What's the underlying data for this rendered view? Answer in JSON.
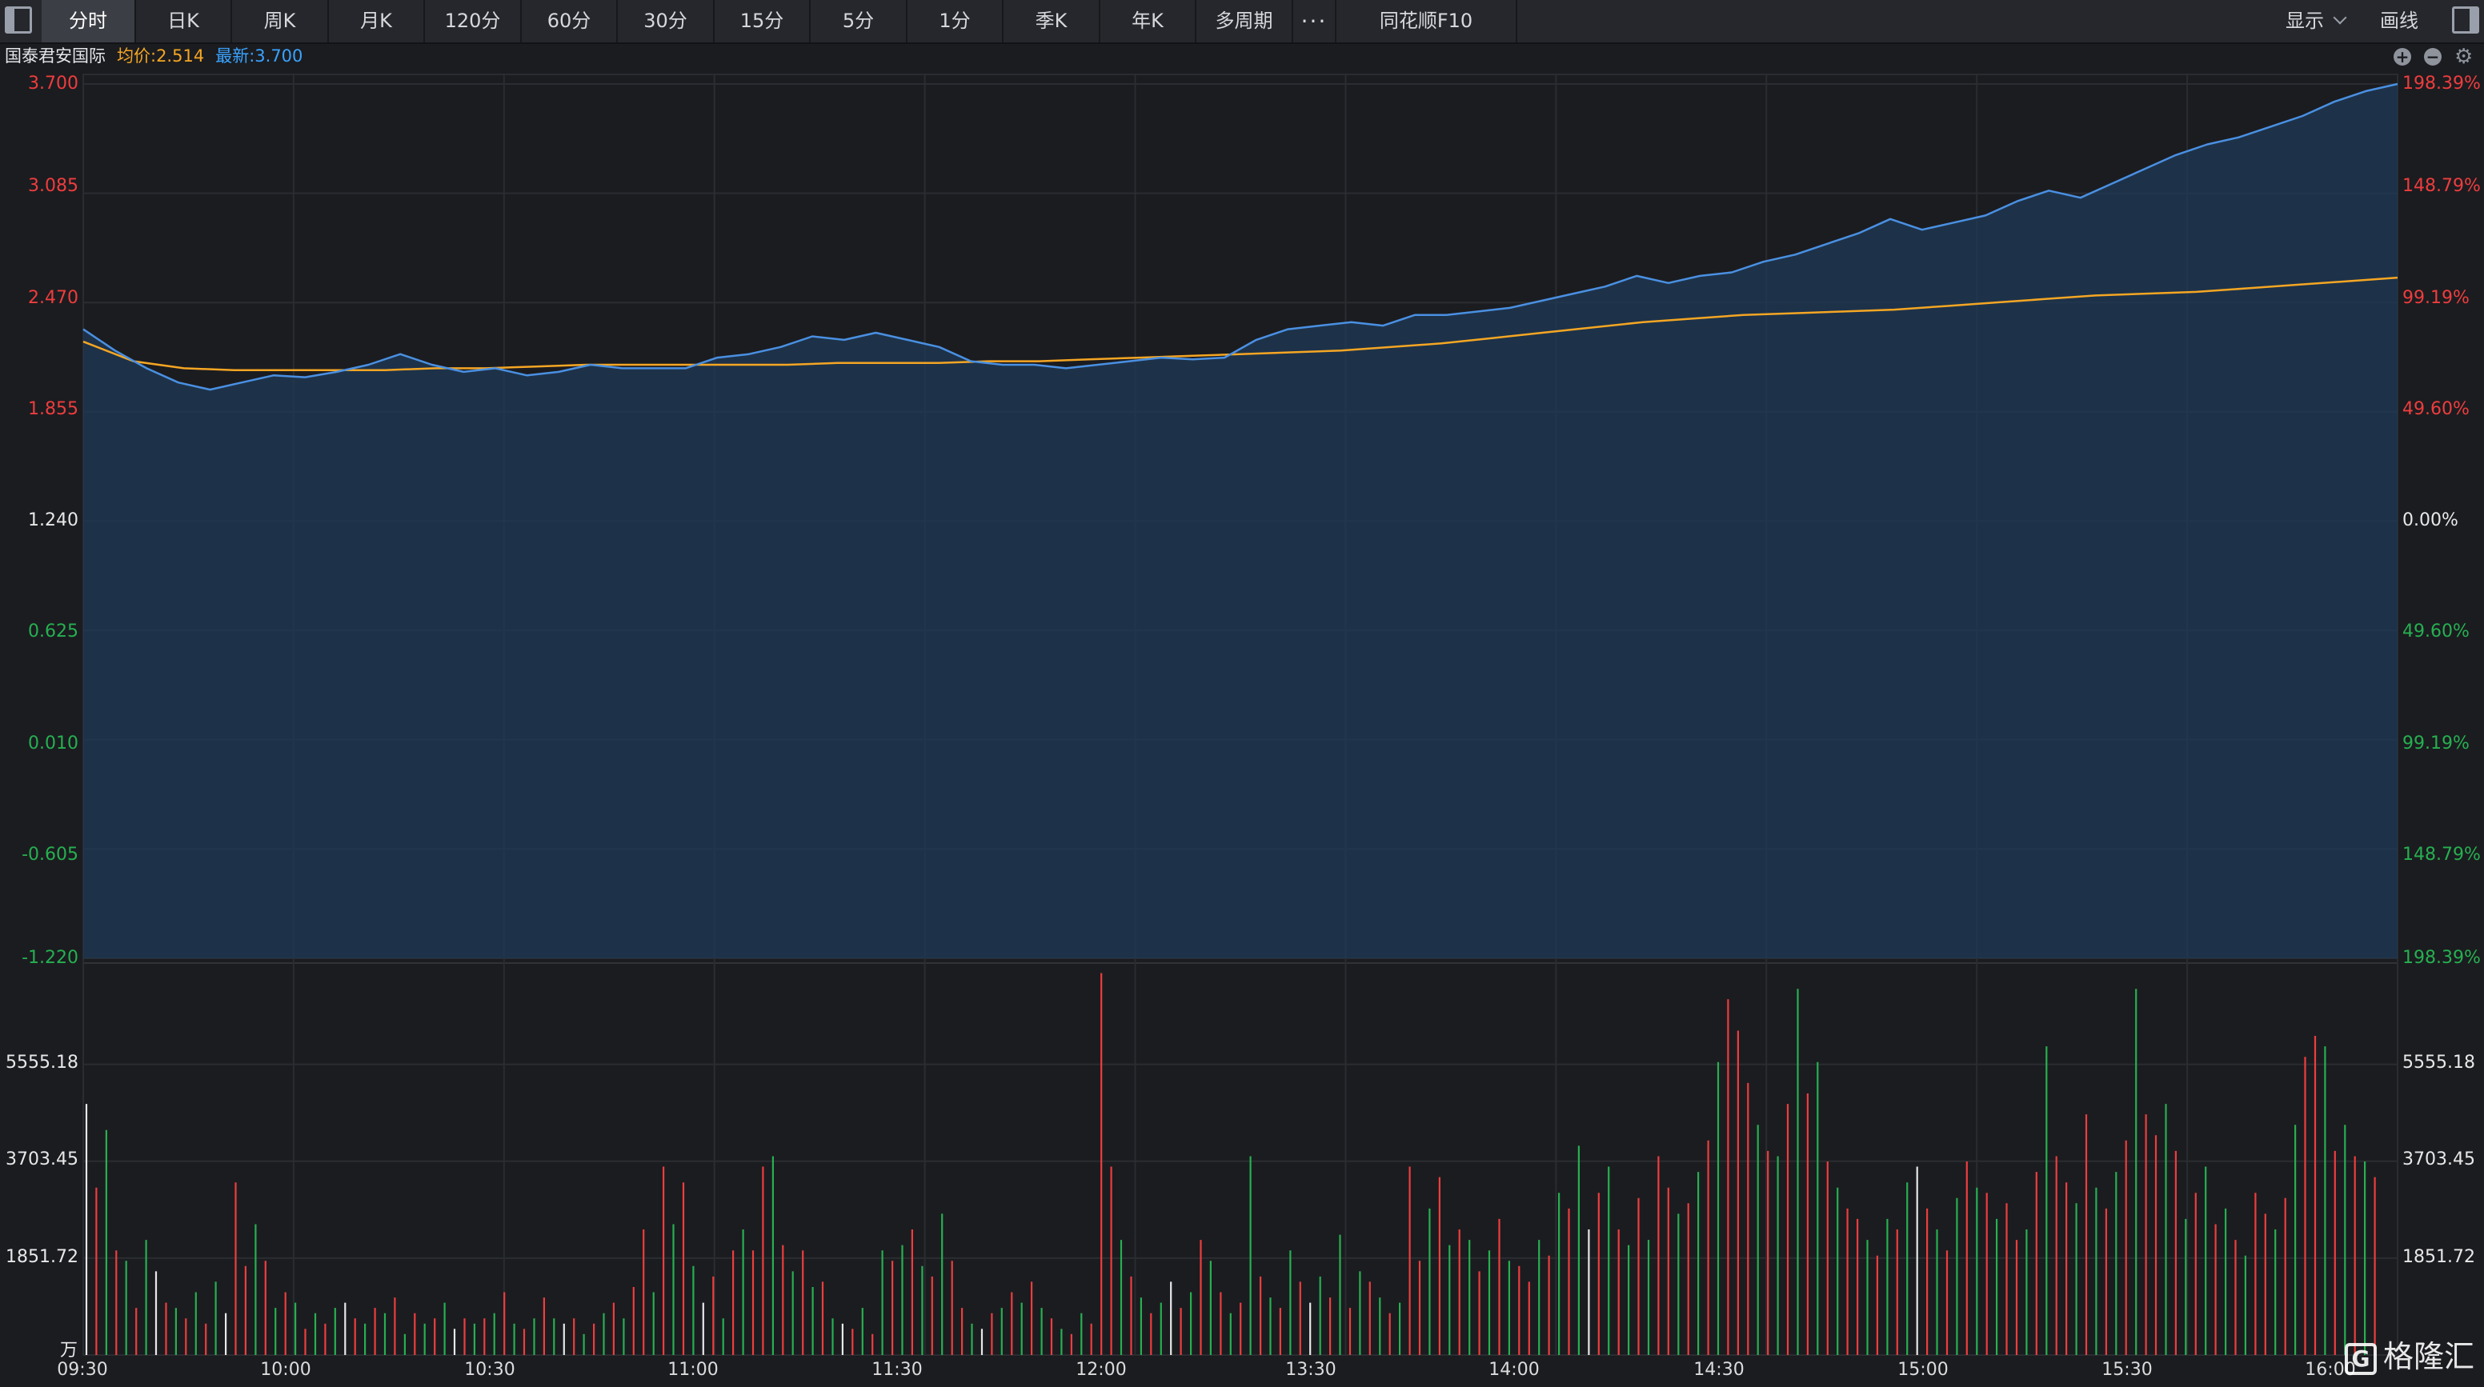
{
  "toolbar": {
    "tabs": [
      "分时",
      "日K",
      "周K",
      "月K",
      "120分",
      "60分",
      "30分",
      "15分",
      "5分",
      "1分",
      "季K",
      "年K",
      "多周期",
      "···",
      "同花顺F10"
    ],
    "active_tab": "分时",
    "display_label": "显示",
    "draw_label": "画线"
  },
  "header": {
    "stock_name": "国泰君安国际",
    "avg_label": "均价:2.514",
    "last_label": "最新:3.700",
    "zoom_in_icon": "+",
    "zoom_out_icon": "−",
    "settings_icon": "⚙"
  },
  "watermark": {
    "icon_letter": "G",
    "text": "格隆汇"
  },
  "colors": {
    "price_line": "#4a90e2",
    "avg_line": "#f5a623",
    "area_fill": "#1f3a57",
    "up": "#ee3d3d",
    "down": "#26b050",
    "flat": "#e8e8e8",
    "grid": "#2a2c31"
  },
  "chart_data": [
    {
      "type": "line",
      "chart": "intraday-price",
      "y_axis_left": [
        "3.700",
        "3.085",
        "2.470",
        "1.855",
        "1.240",
        "0.625",
        "0.010",
        "-0.605",
        "-1.220"
      ],
      "y_axis_right": [
        "198.39%",
        "148.79%",
        "99.19%",
        "49.60%",
        "0.00%",
        "49.60%",
        "99.19%",
        "148.79%",
        "198.39%"
      ],
      "ylim": [
        -1.22,
        3.7
      ],
      "x_ticks": [
        "09:30",
        "10:00",
        "10:30",
        "11:00",
        "11:30",
        "12:00",
        "13:30",
        "14:00",
        "14:30",
        "15:00",
        "15:30",
        "16:00"
      ],
      "price": [
        2.32,
        2.2,
        2.1,
        2.02,
        1.98,
        2.02,
        2.06,
        2.05,
        2.08,
        2.12,
        2.18,
        2.12,
        2.08,
        2.1,
        2.06,
        2.08,
        2.12,
        2.1,
        2.1,
        2.1,
        2.16,
        2.18,
        2.22,
        2.28,
        2.26,
        2.3,
        2.26,
        2.22,
        2.14,
        2.12,
        2.12,
        2.1,
        2.12,
        2.14,
        2.16,
        2.15,
        2.16,
        2.26,
        2.32,
        2.34,
        2.36,
        2.34,
        2.4,
        2.4,
        2.42,
        2.44,
        2.48,
        2.52,
        2.56,
        2.62,
        2.58,
        2.62,
        2.64,
        2.7,
        2.74,
        2.8,
        2.86,
        2.94,
        2.88,
        2.92,
        2.96,
        3.04,
        3.1,
        3.06,
        3.14,
        3.22,
        3.3,
        3.36,
        3.4,
        3.46,
        3.52,
        3.6,
        3.66,
        3.7
      ],
      "avg": [
        2.25,
        2.14,
        2.1,
        2.09,
        2.09,
        2.09,
        2.09,
        2.1,
        2.1,
        2.11,
        2.12,
        2.12,
        2.12,
        2.12,
        2.12,
        2.13,
        2.13,
        2.13,
        2.14,
        2.14,
        2.15,
        2.16,
        2.17,
        2.18,
        2.19,
        2.2,
        2.22,
        2.24,
        2.27,
        2.3,
        2.33,
        2.36,
        2.38,
        2.4,
        2.41,
        2.42,
        2.43,
        2.45,
        2.47,
        2.49,
        2.51,
        2.52,
        2.53,
        2.55,
        2.57,
        2.59,
        2.61
      ],
      "avg_last": 2.514,
      "last": 3.7
    },
    {
      "type": "bar",
      "chart": "volume",
      "unit": "万",
      "y_axis_left": [
        "5555.18",
        "3703.45",
        "1851.72"
      ],
      "y_axis_right": [
        "5555.18",
        "3703.45",
        "1851.72"
      ],
      "ylim": [
        0,
        7400
      ],
      "volume": [
        4800,
        3200,
        4300,
        2000,
        1800,
        900,
        2200,
        1600,
        1000,
        900,
        700,
        1200,
        600,
        1400,
        800,
        3300,
        1700,
        2500,
        1800,
        900,
        1200,
        1000,
        500,
        800,
        600,
        900,
        1000,
        700,
        600,
        900,
        800,
        1100,
        400,
        800,
        600,
        700,
        1000,
        500,
        700,
        600,
        700,
        800,
        1200,
        600,
        500,
        700,
        1100,
        700,
        600,
        700,
        400,
        600,
        800,
        1000,
        700,
        1300,
        2400,
        1200,
        3600,
        2500,
        3300,
        1700,
        1000,
        1500,
        700,
        2000,
        2400,
        2000,
        3600,
        3800,
        2100,
        1600,
        2000,
        1300,
        1400,
        700,
        600,
        500,
        900,
        400,
        2000,
        1800,
        2100,
        2400,
        1700,
        1500,
        2700,
        1800,
        900,
        600,
        500,
        800,
        900,
        1200,
        1000,
        1400,
        900,
        700,
        500,
        400,
        800,
        600,
        7300,
        3600,
        2200,
        1500,
        1100,
        800,
        1000,
        1400,
        900,
        1200,
        2200,
        1800,
        1200,
        800,
        1000,
        3800,
        1500,
        1100,
        900,
        2000,
        1400,
        1000,
        1500,
        1100,
        2300,
        900,
        1600,
        1400,
        1100,
        800,
        1000,
        3600,
        1800,
        2800,
        3400,
        2100,
        2400,
        2200,
        1600,
        2000,
        2600,
        1800,
        1700,
        1400,
        2200,
        1900,
        3100,
        2800,
        4000,
        2400,
        3100,
        3600,
        2400,
        2100,
        3000,
        2200,
        3800,
        3200,
        2700,
        2900,
        3500,
        4100,
        5600,
        6800,
        6200,
        5200,
        4400,
        3900,
        3800,
        4800,
        7000,
        5000,
        5600,
        3700,
        3200,
        2800,
        2600,
        2200,
        1900,
        2600,
        2400,
        3300,
        3600,
        2800,
        2400,
        2000,
        3000,
        3700,
        3200,
        3100,
        2600,
        2900,
        2200,
        2400,
        3500,
        5900,
        3800,
        3300,
        2900,
        4600,
        3200,
        2800,
        3500,
        4100,
        7000,
        4600,
        4200,
        4800,
        3900,
        2600,
        3100,
        3600,
        2500,
        2800,
        2200,
        1900,
        3100,
        2700,
        2400,
        3000,
        4400,
        5700,
        6100,
        5900,
        3900,
        4400,
        3800,
        3700,
        3400
      ],
      "direction": [
        "f",
        "u",
        "d",
        "u",
        "d",
        "u",
        "d",
        "f",
        "u",
        "d",
        "u",
        "d",
        "u",
        "d",
        "f",
        "u",
        "u",
        "d",
        "u",
        "d",
        "u",
        "d",
        "u",
        "d",
        "u",
        "d",
        "f",
        "u",
        "d",
        "u",
        "d",
        "u",
        "d",
        "u",
        "d",
        "u",
        "d",
        "f",
        "u",
        "d",
        "u",
        "d",
        "u",
        "d",
        "u",
        "d",
        "u",
        "d",
        "f",
        "u",
        "d",
        "u",
        "d",
        "u",
        "d",
        "u",
        "u",
        "d",
        "u",
        "d",
        "u",
        "d",
        "f",
        "u",
        "d",
        "u",
        "d",
        "u",
        "u",
        "d",
        "u",
        "d",
        "u",
        "d",
        "u",
        "d",
        "f",
        "u",
        "d",
        "u",
        "d",
        "u",
        "d",
        "u",
        "d",
        "u",
        "d",
        "u",
        "u",
        "d",
        "f",
        "u",
        "d",
        "u",
        "d",
        "u",
        "d",
        "u",
        "d",
        "u",
        "d",
        "u",
        "u",
        "u",
        "d",
        "u",
        "d",
        "u",
        "d",
        "f",
        "u",
        "d",
        "u",
        "d",
        "u",
        "d",
        "u",
        "d",
        "u",
        "d",
        "u",
        "d",
        "u",
        "f",
        "d",
        "u",
        "d",
        "u",
        "d",
        "u",
        "d",
        "u",
        "d",
        "u",
        "u",
        "d",
        "u",
        "d",
        "u",
        "d",
        "u",
        "d",
        "u",
        "d",
        "u",
        "u",
        "d",
        "u",
        "d",
        "u",
        "d",
        "f",
        "u",
        "d",
        "u",
        "d",
        "u",
        "d",
        "u",
        "u",
        "d",
        "u",
        "d",
        "u",
        "d",
        "u",
        "u",
        "u",
        "d",
        "u",
        "d",
        "u",
        "d",
        "u",
        "d",
        "u",
        "d",
        "u",
        "u",
        "d",
        "u",
        "d",
        "u",
        "d",
        "f",
        "u",
        "d",
        "u",
        "d",
        "u",
        "d",
        "u",
        "d",
        "u",
        "u",
        "d",
        "u",
        "d",
        "u",
        "u",
        "d",
        "u",
        "d",
        "u",
        "d",
        "u",
        "d",
        "u",
        "u",
        "d",
        "u",
        "d",
        "u",
        "d",
        "u",
        "d",
        "u",
        "d",
        "u",
        "u",
        "d",
        "u",
        "d",
        "u",
        "u",
        "d",
        "u",
        "d",
        "u",
        "d",
        "u",
        "d",
        "u",
        "u",
        "d",
        "u",
        "d",
        "u",
        "f"
      ]
    }
  ]
}
